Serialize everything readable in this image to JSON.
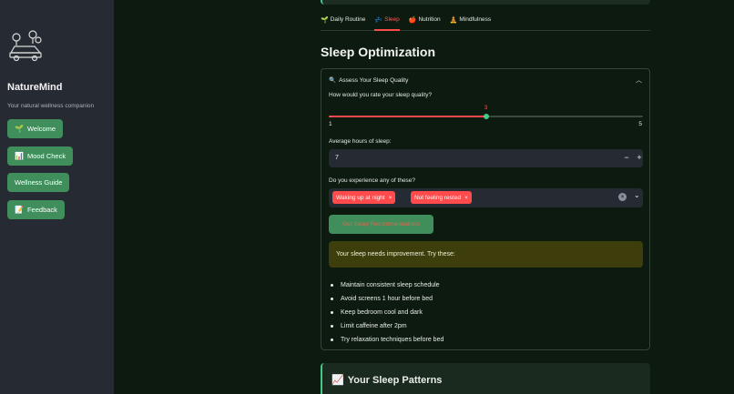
{
  "sidebar": {
    "app_name": "NatureMind",
    "tagline": "Your natural wellness companion",
    "logo_icon": "car-with-trees-logo-icon",
    "buttons": [
      {
        "label": "Welcome",
        "icon": "🌱"
      },
      {
        "label": "Mood Check",
        "icon": "📊"
      },
      {
        "label": "Wellness Guide",
        "icon": ""
      },
      {
        "label": "Feedback",
        "icon": "📝"
      }
    ]
  },
  "tabs": [
    {
      "label": "Daily Routine",
      "icon": "🌱",
      "active": false
    },
    {
      "label": "Sleep",
      "icon": "💤",
      "active": true
    },
    {
      "label": "Nutrition",
      "icon": "🍎",
      "active": false
    },
    {
      "label": "Mindfulness",
      "icon": "🧘",
      "active": false
    }
  ],
  "main": {
    "section_title": "Sleep Optimization",
    "expander": {
      "icon": "🔍",
      "label": "Assess Your Sleep Quality",
      "quality": {
        "label": "How would you rate your sleep quality?",
        "value": "3",
        "min": "1",
        "max": "5",
        "fraction": 0.5
      },
      "hours": {
        "label": "Average hours of sleep:",
        "value": "7",
        "minus": "−",
        "plus": "+"
      },
      "issues": {
        "label": "Do you experience any of these?",
        "selected": [
          "Waking up at night",
          "Not feeling rested"
        ],
        "remove_glyph": "×"
      },
      "button_label": "Get Sleep Recommendations",
      "alert": "Your sleep needs improvement. Try these:",
      "tips": [
        "Maintain consistent sleep schedule",
        "Avoid screens 1 hour before bed",
        "Keep bedroom cool and dark",
        "Limit caffeine after 2pm",
        "Try relaxation techniques before bed"
      ]
    },
    "patterns": {
      "icon": "📈",
      "title": "Your Sleep Patterns"
    }
  },
  "colors": {
    "accent_green": "#3f8e5c",
    "accent_red": "#ff4b4b",
    "background": "#0c1a10",
    "sidebar": "#262b33"
  }
}
